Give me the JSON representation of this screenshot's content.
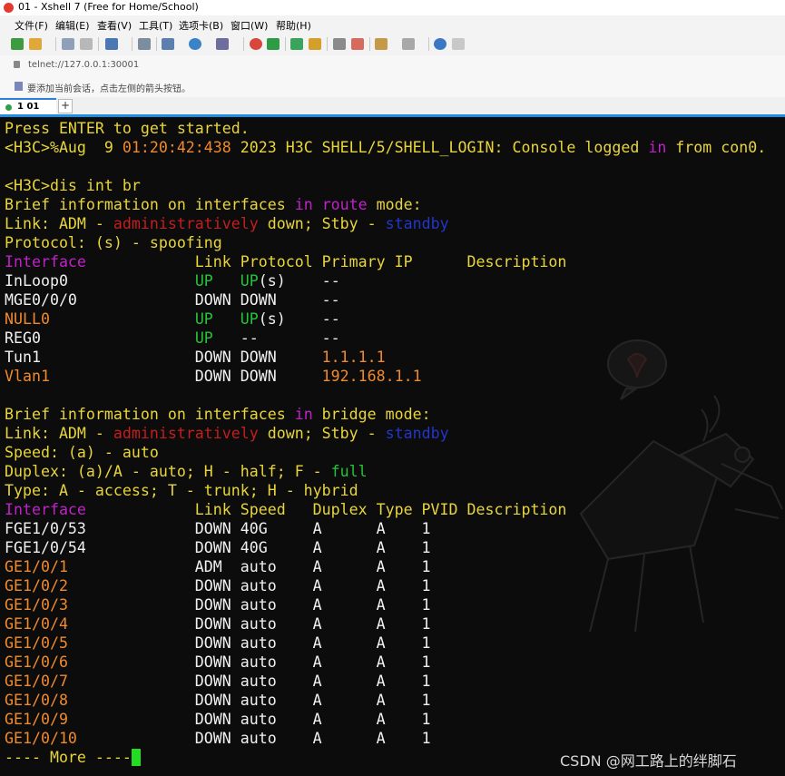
{
  "window": {
    "title": "01 - Xshell 7 (Free for Home/School)"
  },
  "menu": [
    "文件(F)",
    "编辑(E)",
    "查看(V)",
    "工具(T)",
    "选项卡(B)",
    "窗口(W)",
    "帮助(H)"
  ],
  "address": {
    "url": "telnet://127.0.0.1:30001"
  },
  "hint": {
    "text": "要添加当前会话，点击左侧的箭头按钮。"
  },
  "tab": {
    "label": "1 01"
  },
  "tab_add_label": "+",
  "colors": {
    "yellow": "#e8d53d",
    "red": "#c41e1e",
    "blue": "#2336c8",
    "green": "#26c33a",
    "orange": "#f08a2e",
    "magenta": "#c021c9",
    "white": "#f0f0f0",
    "cursor": "#22dd22",
    "accent": "#2f7ed8"
  },
  "terminal": {
    "lines": [
      [
        [
          "Press ENTER to get started.",
          "y"
        ]
      ],
      [
        [
          "<H3C>%Aug  9 ",
          "y"
        ],
        [
          "01:20:42:438",
          "o"
        ],
        [
          " 2023 H3C SHELL/5/SHELL_LOGIN: Console logged ",
          "y"
        ],
        [
          "in",
          "m"
        ],
        [
          " from con0.",
          "y"
        ]
      ],
      [],
      [
        [
          "<H3C>dis int br",
          "y"
        ]
      ],
      [
        [
          "Brief information on interfaces ",
          "y"
        ],
        [
          "in",
          "m"
        ],
        [
          " ",
          "y"
        ],
        [
          "route",
          "m"
        ],
        [
          " mode:",
          "y"
        ]
      ],
      [
        [
          "Link: ADM - ",
          "y"
        ],
        [
          "administratively",
          "r"
        ],
        [
          " down; Stby - ",
          "y"
        ],
        [
          "standby",
          "b"
        ]
      ],
      [
        [
          "Protocol: (s) - spoofing",
          "y"
        ]
      ],
      [
        [
          "Interface",
          "m"
        ],
        [
          "            Link Protocol Primary IP      Description",
          "y"
        ]
      ],
      [
        [
          "InLoop0",
          "w"
        ],
        [
          "              ",
          "w"
        ],
        [
          "UP",
          "g"
        ],
        [
          "   ",
          "w"
        ],
        [
          "UP",
          "g"
        ],
        [
          "(s)",
          "w"
        ],
        [
          "    --",
          "w"
        ]
      ],
      [
        [
          "MGE0/0/0             DOWN DOWN     --",
          "w"
        ]
      ],
      [
        [
          "NULL0",
          "o"
        ],
        [
          "                ",
          "w"
        ],
        [
          "UP",
          "g"
        ],
        [
          "   ",
          "w"
        ],
        [
          "UP",
          "g"
        ],
        [
          "(s)",
          "w"
        ],
        [
          "    --",
          "w"
        ]
      ],
      [
        [
          "REG0",
          "w"
        ],
        [
          "                 ",
          "w"
        ],
        [
          "UP",
          "g"
        ],
        [
          "   --       --",
          "w"
        ]
      ],
      [
        [
          "Tun1                 DOWN DOWN     ",
          "w"
        ],
        [
          "1.1.1.1",
          "o"
        ]
      ],
      [
        [
          "Vlan1",
          "o"
        ],
        [
          "                DOWN DOWN     ",
          "w"
        ],
        [
          "192.168.1.1",
          "o"
        ]
      ],
      [],
      [
        [
          "Brief information on interfaces ",
          "y"
        ],
        [
          "in",
          "m"
        ],
        [
          " bridge mode:",
          "y"
        ]
      ],
      [
        [
          "Link: ADM - ",
          "y"
        ],
        [
          "administratively",
          "r"
        ],
        [
          " down; Stby - ",
          "y"
        ],
        [
          "standby",
          "b"
        ]
      ],
      [
        [
          "Speed: (a) - auto",
          "y"
        ]
      ],
      [
        [
          "Duplex: (a)/A - auto; H - half; F - ",
          "y"
        ],
        [
          "full",
          "g"
        ]
      ],
      [
        [
          "Type: A - access; T - trunk; H - hybrid",
          "y"
        ]
      ],
      [
        [
          "Interface",
          "m"
        ],
        [
          "            Link Speed   Duplex Type PVID Description",
          "y"
        ]
      ],
      [
        [
          "FGE1/0/53            DOWN 40G     A      A    1",
          "w"
        ]
      ],
      [
        [
          "FGE1/0/54            DOWN 40G     A      A    1",
          "w"
        ]
      ],
      [
        [
          "GE1/0/1",
          "o"
        ],
        [
          "              ADM  auto    A      A    1",
          "w"
        ]
      ],
      [
        [
          "GE1/0/2",
          "o"
        ],
        [
          "              DOWN auto    A      A    1",
          "w"
        ]
      ],
      [
        [
          "GE1/0/3",
          "o"
        ],
        [
          "              DOWN auto    A      A    1",
          "w"
        ]
      ],
      [
        [
          "GE1/0/4",
          "o"
        ],
        [
          "              DOWN auto    A      A    1",
          "w"
        ]
      ],
      [
        [
          "GE1/0/5",
          "o"
        ],
        [
          "              DOWN auto    A      A    1",
          "w"
        ]
      ],
      [
        [
          "GE1/0/6",
          "o"
        ],
        [
          "              DOWN auto    A      A    1",
          "w"
        ]
      ],
      [
        [
          "GE1/0/7",
          "o"
        ],
        [
          "              DOWN auto    A      A    1",
          "w"
        ]
      ],
      [
        [
          "GE1/0/8",
          "o"
        ],
        [
          "              DOWN auto    A      A    1",
          "w"
        ]
      ],
      [
        [
          "GE1/0/9",
          "o"
        ],
        [
          "              DOWN auto    A      A    1",
          "w"
        ]
      ],
      [
        [
          "GE1/0/10",
          "o"
        ],
        [
          "             DOWN auto    A      A    1",
          "w"
        ]
      ],
      [
        [
          "---- More ----",
          "y"
        ]
      ]
    ]
  },
  "watermark": {
    "text": "CSDN @网工路上的绊脚石"
  }
}
